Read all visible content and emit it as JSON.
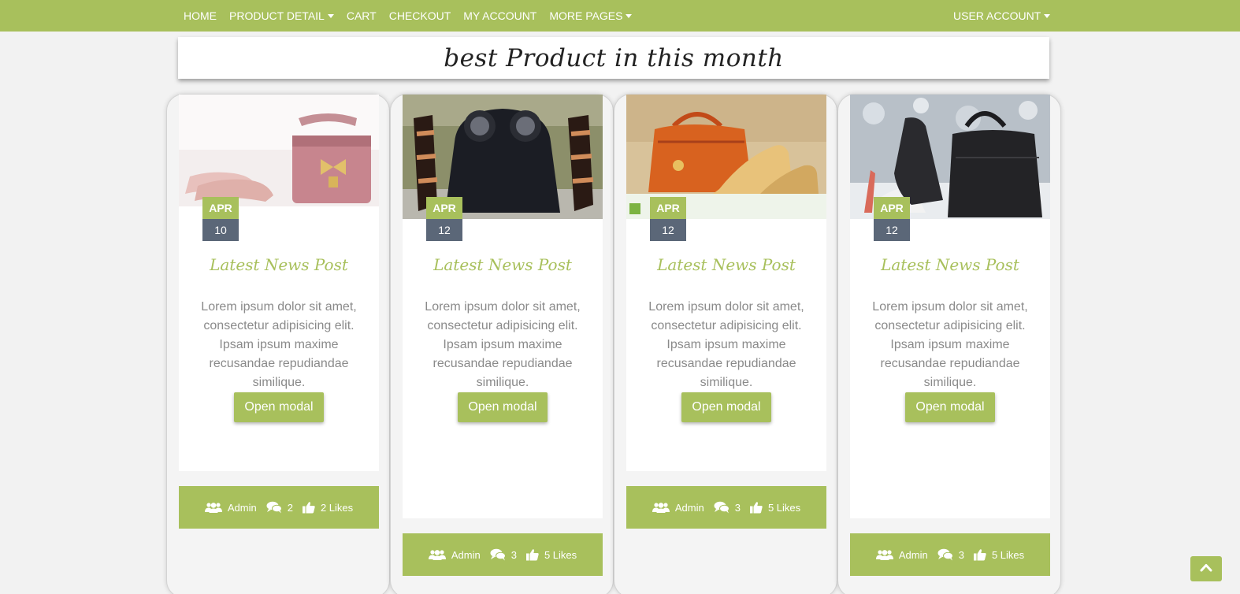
{
  "nav": {
    "items": [
      {
        "label": "HOME",
        "dropdown": false
      },
      {
        "label": "PRODUCT DETAIL",
        "dropdown": true
      },
      {
        "label": "CART",
        "dropdown": false
      },
      {
        "label": "CHECKOUT",
        "dropdown": false
      },
      {
        "label": "MY ACCOUNT",
        "dropdown": false
      },
      {
        "label": "MORE PAGES",
        "dropdown": true
      }
    ],
    "user_account": "USER ACCOUNT"
  },
  "section_title": "best Product in this month",
  "cards": [
    {
      "month": "APR",
      "day": "10",
      "title": "Latest News Post",
      "body": "Lorem ipsum dolor sit amet, consectetur adipisicing elit. Ipsam ipsum maxime recusandae repudiandae similique.",
      "button": "Open modal",
      "author": "Admin",
      "comments": "2",
      "likes": "2 Likes",
      "image": "pink-heels-and-handbag"
    },
    {
      "month": "APR",
      "day": "12",
      "title": "Latest News Post",
      "body": "Lorem ipsum dolor sit amet, consectetur adipisicing elit. Ipsam ipsum maxime recusandae repudiandae similique.",
      "button": "Open modal",
      "author": "Admin",
      "comments": "3",
      "likes": "5 Likes",
      "image": "black-handbag-and-sandals"
    },
    {
      "month": "APR",
      "day": "12",
      "title": "Latest News Post",
      "body": "Lorem ipsum dolor sit amet, consectetur adipisicing elit. Ipsam ipsum maxime recusandae repudiandae similique.",
      "button": "Open modal",
      "author": "Admin",
      "comments": "3",
      "likes": "5 Likes",
      "image": "orange-handbag-and-heels"
    },
    {
      "month": "APR",
      "day": "12",
      "title": "Latest News Post",
      "body": "Lorem ipsum dolor sit amet, consectetur adipisicing elit. Ipsam ipsum maxime recusandae repudiandae similique.",
      "button": "Open modal",
      "author": "Admin",
      "comments": "3",
      "likes": "5 Likes",
      "image": "black-stiletto-and-handbag"
    }
  ],
  "colors": {
    "accent": "#a8c05c",
    "date_day_bg": "#5b6778",
    "body_text": "#8a8a8a",
    "page_bg": "#f2f2f2"
  },
  "icons": {
    "author": "users-icon",
    "comments": "comments-icon",
    "likes": "thumbs-up-icon",
    "scroll_top": "chevron-up-icon"
  }
}
